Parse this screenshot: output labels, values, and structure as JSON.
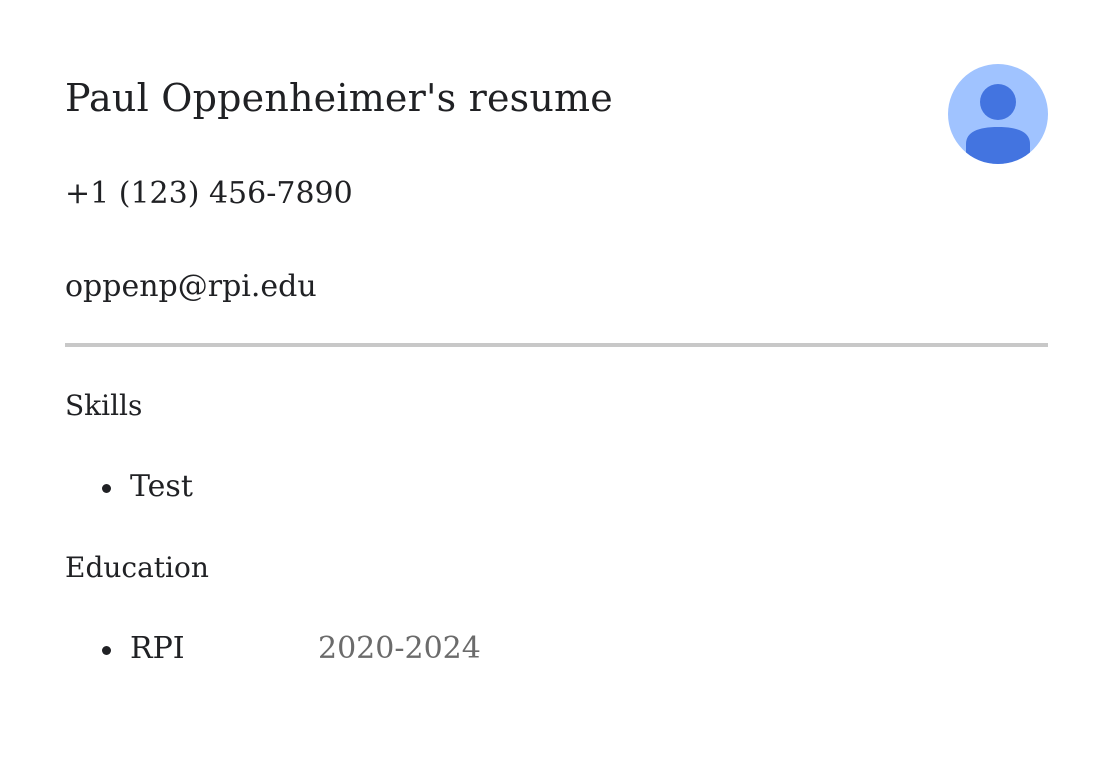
{
  "header": {
    "title": "Paul Oppenheimer's resume",
    "avatar_icon": "person-avatar-icon",
    "avatar_bg_color": "#a0c3ff",
    "avatar_fg_color": "#4374e0"
  },
  "contact": {
    "phone": "+1 (123) 456-7890",
    "email": "oppenp@rpi.edu"
  },
  "sections": {
    "skills": {
      "heading": "Skills",
      "items": [
        {
          "label": "Test"
        }
      ]
    },
    "education": {
      "heading": "Education",
      "items": [
        {
          "label": "RPI",
          "dates": "2020-2024"
        }
      ]
    }
  }
}
